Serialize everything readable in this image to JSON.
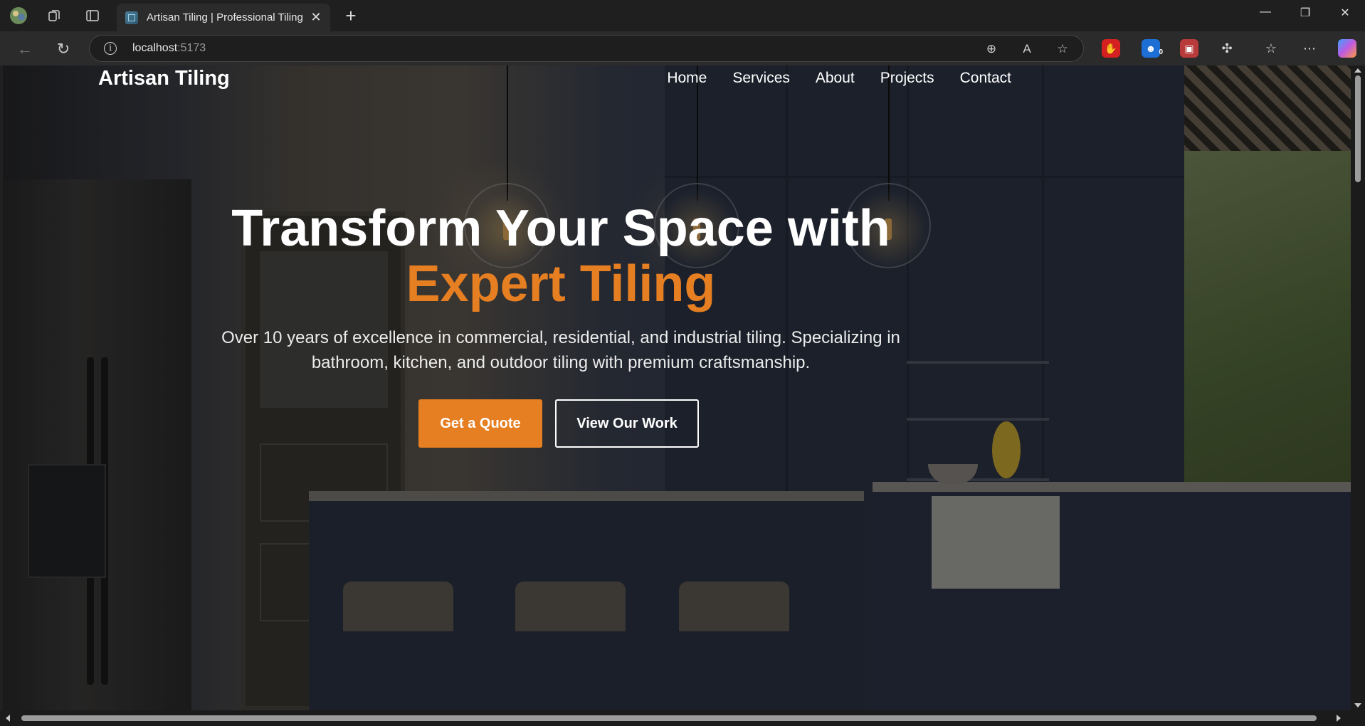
{
  "browser": {
    "tab_title": "Artisan Tiling | Professional Tiling",
    "url_host": "localhost",
    "url_port": ":5173",
    "extension_badge": "0"
  },
  "site": {
    "logo": "Artisan Tiling",
    "nav": [
      "Home",
      "Services",
      "About",
      "Projects",
      "Contact"
    ],
    "hero": {
      "title_line1": "Transform Your Space with",
      "title_accent": "Expert Tiling",
      "subtitle_line1": "Over 10 years of excellence in commercial, residential, and industrial tiling. Specializing in",
      "subtitle_line2": "bathroom, kitchen, and outdoor tiling with premium craftsmanship.",
      "primary_button": "Get a Quote",
      "secondary_button": "View Our Work"
    }
  },
  "colors": {
    "accent": "#e67e22",
    "text": "#ffffff"
  }
}
